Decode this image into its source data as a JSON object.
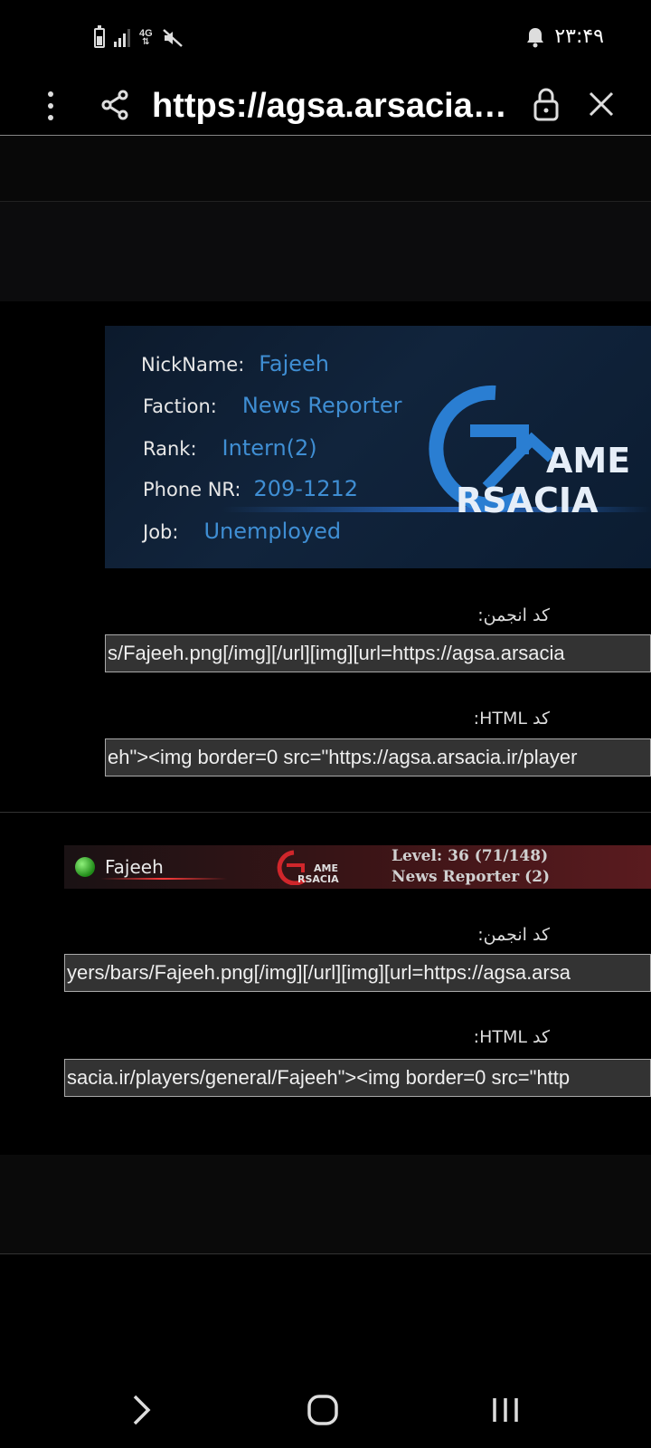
{
  "status_bar": {
    "time": "۲۳:۴۹",
    "network": "4G",
    "icons": [
      "battery-icon",
      "signal-icon",
      "network-4g-icon",
      "mute-icon",
      "bell-icon"
    ]
  },
  "browser": {
    "url": "https://agsa.arsacia.i...",
    "icons": [
      "menu-dots-icon",
      "share-icon",
      "lock-icon",
      "close-icon"
    ]
  },
  "signature": {
    "rows": [
      {
        "label": "NickName:",
        "value": "Fajeeh"
      },
      {
        "label": "Faction:",
        "value": "News Reporter"
      },
      {
        "label": "Rank:",
        "value": "Intern(2)"
      },
      {
        "label": "Phone NR:",
        "value": "209-1212"
      },
      {
        "label": "Job:",
        "value": "Unemployed"
      }
    ],
    "logo_line1": "AME",
    "logo_line2": "RSACIA",
    "forum_label": "کد انجمن:",
    "forum_code": "s/Fajeeh.png[/img][/url][img][url=https://agsa.arsacia",
    "html_label": "کد HTML:",
    "html_code": "eh\"><img border=0 src=\"https://agsa.arsacia.ir/player"
  },
  "bar": {
    "name": "Fajeeh",
    "level": "Level: 36 (71/148)",
    "faction": "News Reporter (2)",
    "logo_line1": "AME",
    "logo_line2": "RSACIA",
    "forum_label": "کد انجمن:",
    "forum_code": "yers/bars/Fajeeh.png[/img][/url][img][url=https://agsa.arsa",
    "html_label": "کد HTML:",
    "html_code": "sacia.ir/players/general/Fajeeh\"><img border=0 src=\"http"
  },
  "colors": {
    "accent_blue": "#3f8ed3",
    "bar_red": "#5a1b1f",
    "online_green": "#2fbf1f"
  }
}
